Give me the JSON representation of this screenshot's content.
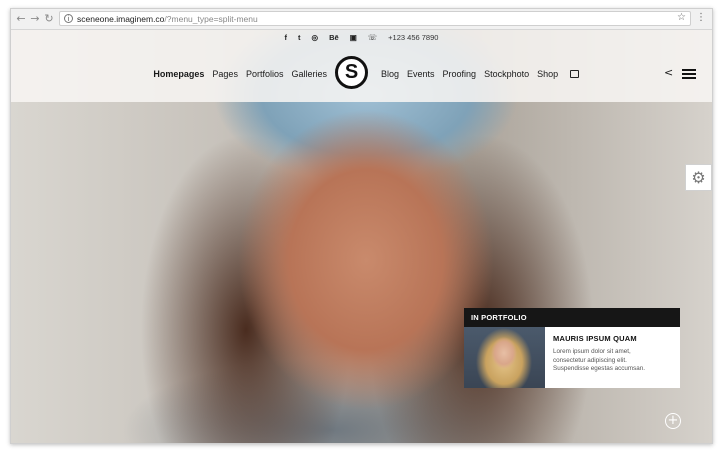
{
  "browser": {
    "url_host": "sceneone.imaginem.co",
    "url_path": "/?menu_type=split-menu",
    "back_icon": "arrow-left",
    "forward_icon": "arrow-right",
    "reload_icon": "reload"
  },
  "social": {
    "icons": [
      "f",
      "t",
      "◎",
      "Bē",
      "▣"
    ],
    "phone": "+123 456 7890"
  },
  "nav": {
    "left": [
      "Homepages",
      "Pages",
      "Portfolios",
      "Galleries"
    ],
    "right": [
      "Blog",
      "Events",
      "Proofing",
      "Stockphoto",
      "Shop"
    ],
    "active": "Homepages",
    "logo_letter": "S"
  },
  "portfolio_card": {
    "heading": "IN PORTFOLIO",
    "title": "MAURIS IPSUM QUAM",
    "desc_line1": "Lorem ipsum dolor sit amet,",
    "desc_line2": "consectetur adipiscing elit.",
    "desc_line3": "Suspendisse egestas accumsan."
  },
  "colors": {
    "accent_dark": "#161616",
    "background": "#f5f4f2"
  }
}
